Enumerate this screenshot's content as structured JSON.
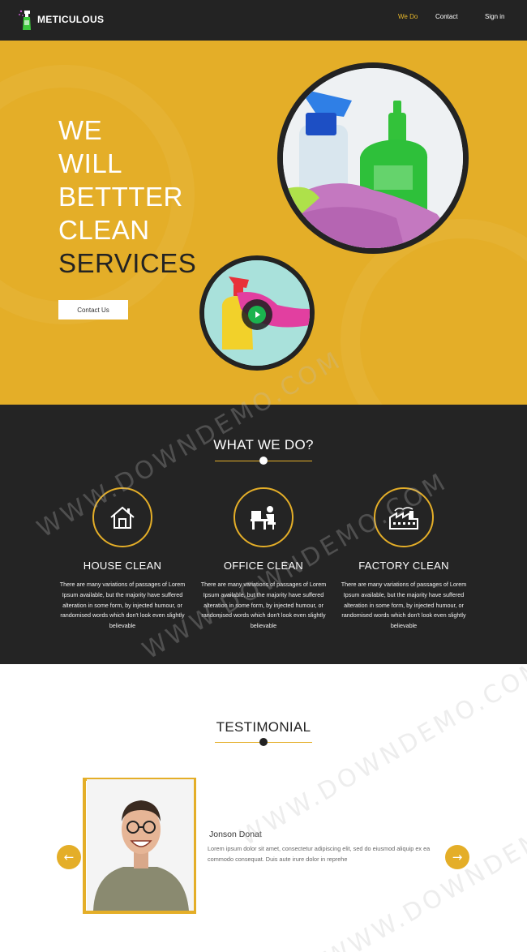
{
  "header": {
    "brand": "METICULOUS",
    "nav": [
      {
        "label": "We Do",
        "active": true
      },
      {
        "label": "Contact",
        "active": false
      },
      {
        "label": "Sign in",
        "active": false
      }
    ]
  },
  "hero": {
    "lines": [
      "WE",
      "WILL",
      "BETTTER",
      "CLEAN",
      "SERVICES"
    ],
    "cta_label": "Contact Us"
  },
  "services": {
    "title": "WHAT WE DO?",
    "items": [
      {
        "name": "HOUSE CLEAN",
        "icon": "house-icon",
        "desc": "There are many variations of passages of Lorem Ipsum available, but the majority have suffered alteration in some form, by injected humour, or randomised words which don't look even slightly believable"
      },
      {
        "name": "OFFICE CLEAN",
        "icon": "office-desk-icon",
        "desc": "There are many variations of passages of Lorem Ipsum available, but the majority have suffered alteration in some form, by injected humour, or randomised words which don't look even slightly believable"
      },
      {
        "name": "FACTORY CLEAN",
        "icon": "factory-icon",
        "desc": "There are many variations of passages of Lorem Ipsum available, but the majority have suffered alteration in some form, by injected humour, or randomised words which don't look even slightly believable"
      }
    ]
  },
  "testimonial": {
    "title": "TESTIMONIAL",
    "name": "Jonson Donat",
    "text": "Lorem ipsum dolor sit amet, consectetur adipiscing elit, sed do eiusmod aliquip ex ea commodo consequat. Duis aute irure dolor in reprehe",
    "prev_icon": "arrow-left-icon",
    "next_icon": "arrow-right-icon"
  },
  "watermark": "WWW.DOWNDEMO.COM",
  "colors": {
    "accent": "#e4ae28",
    "dark": "#232323",
    "services_bg": "#242424",
    "play_green": "#1bb34e"
  }
}
